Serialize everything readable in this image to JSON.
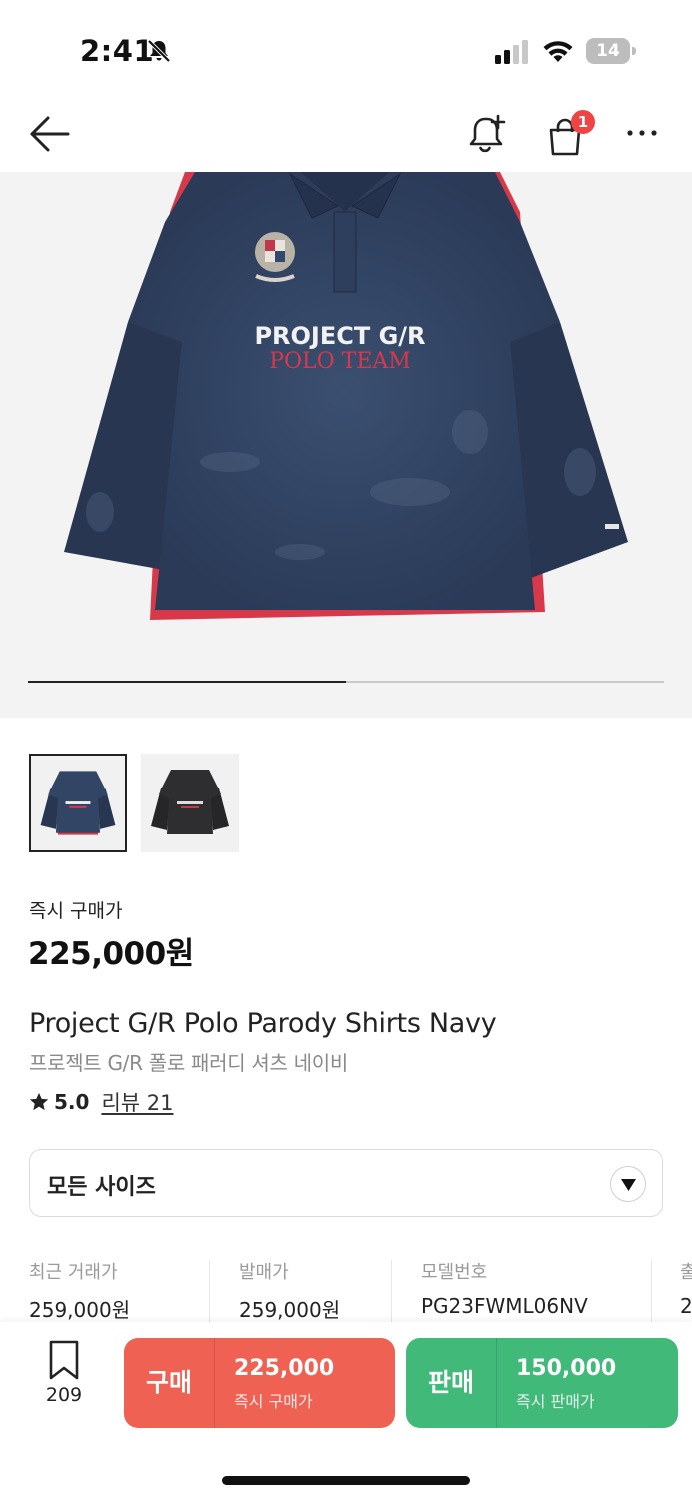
{
  "status_bar": {
    "time": "2:41",
    "battery": "14"
  },
  "nav": {
    "cart_badge": "1",
    "icons": [
      "back-arrow-icon",
      "notification-add-icon",
      "shopping-bag-icon",
      "more-icon"
    ]
  },
  "hero": {
    "print_line1": "PROJECT G/R",
    "print_line2": "POLO TEAM",
    "slide_progress": 0.5
  },
  "thumbnails": [
    {
      "color": "navy",
      "selected": true
    },
    {
      "color": "black",
      "selected": false
    }
  ],
  "price": {
    "label": "즉시 구매가",
    "value": "225,000원"
  },
  "product": {
    "title_en": "Project G/R Polo Parody Shirts Navy",
    "title_ko": "프로젝트 G/R 폴로 패러디 셔츠 네이비",
    "rating": "5.0",
    "review": "리뷰 21"
  },
  "size_select": {
    "label": "모든 사이즈"
  },
  "info": [
    {
      "label": "최근 거래가",
      "value": "259,000원"
    },
    {
      "label": "발매가",
      "value": "259,000원"
    },
    {
      "label": "모델번호",
      "value": "PG23FWML06NV"
    },
    {
      "label": "출",
      "value": "2"
    }
  ],
  "bottom": {
    "bookmark_count": "209",
    "buy": {
      "label": "구매",
      "price": "225,000",
      "sub": "즉시 구매가"
    },
    "sell": {
      "label": "판매",
      "price": "150,000",
      "sub": "즉시 판매가"
    }
  },
  "colors": {
    "buy": "#ef6253",
    "sell": "#41b979",
    "badge": "#ef4444",
    "shirt_navy": "#2c3d5a",
    "shirt_red": "#d8394a"
  }
}
